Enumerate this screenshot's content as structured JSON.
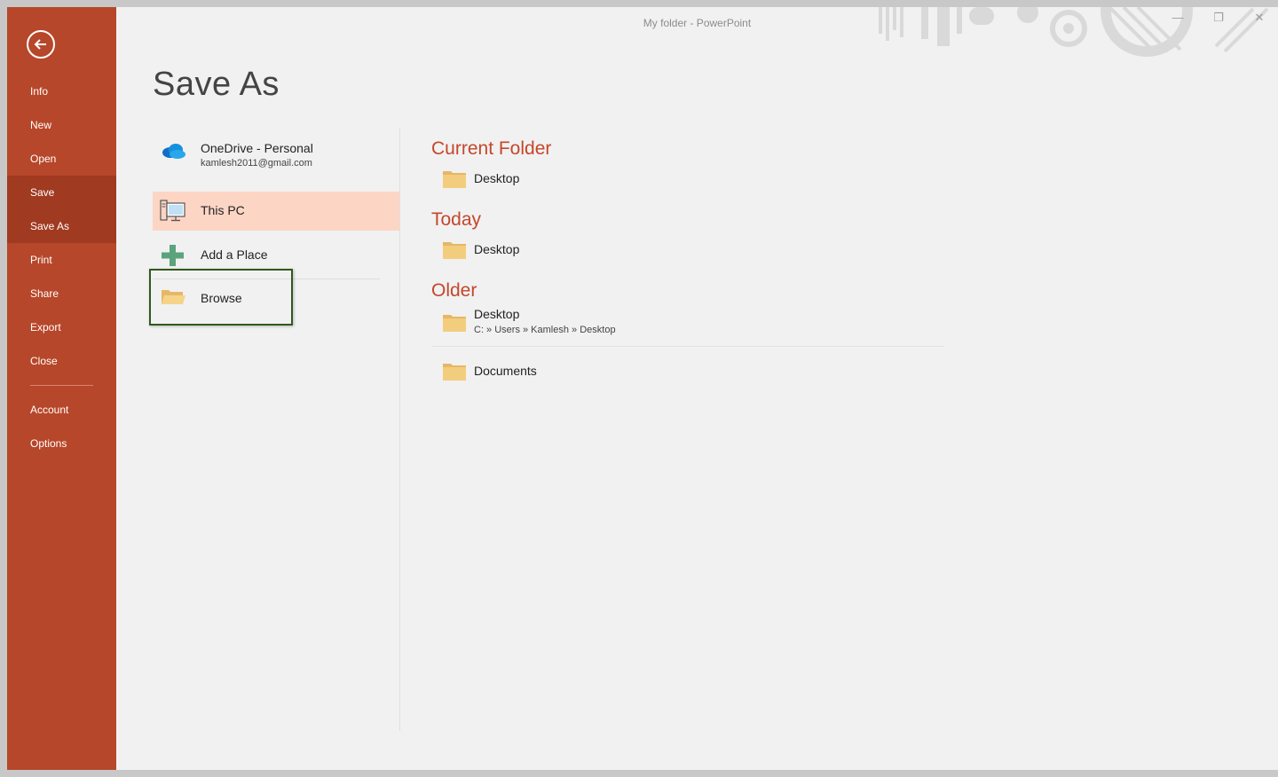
{
  "window": {
    "title": "My folder - PowerPoint",
    "accent": "#b7472a",
    "heading_color": "#c4472b",
    "selected_bg": "#fcd5c4"
  },
  "sidebar": {
    "back_icon": "back-arrow-icon",
    "items": [
      {
        "label": "Info"
      },
      {
        "label": "New"
      },
      {
        "label": "Open"
      },
      {
        "label": "Save"
      },
      {
        "label": "Save As"
      },
      {
        "label": "Print"
      },
      {
        "label": "Share"
      },
      {
        "label": "Export"
      },
      {
        "label": "Close"
      }
    ],
    "bottom_items": [
      {
        "label": "Account"
      },
      {
        "label": "Options"
      }
    ]
  },
  "page": {
    "title": "Save As"
  },
  "locations": {
    "onedrive": {
      "name": "OneDrive - Personal",
      "account": "kamlesh2011@gmail.com",
      "icon": "cloud-icon"
    },
    "this_pc": {
      "name": "This PC",
      "icon": "computer-icon"
    },
    "add_place": {
      "name": "Add a Place",
      "icon": "plus-icon"
    },
    "browse": {
      "name": "Browse",
      "icon": "open-folder-icon"
    }
  },
  "folders": {
    "current": {
      "title": "Current Folder",
      "items": [
        {
          "name": "Desktop"
        }
      ]
    },
    "today": {
      "title": "Today",
      "items": [
        {
          "name": "Desktop"
        }
      ]
    },
    "older": {
      "title": "Older",
      "items": [
        {
          "name": "Desktop",
          "path": "C: » Users » Kamlesh » Desktop"
        },
        {
          "name": "Documents"
        }
      ]
    }
  }
}
